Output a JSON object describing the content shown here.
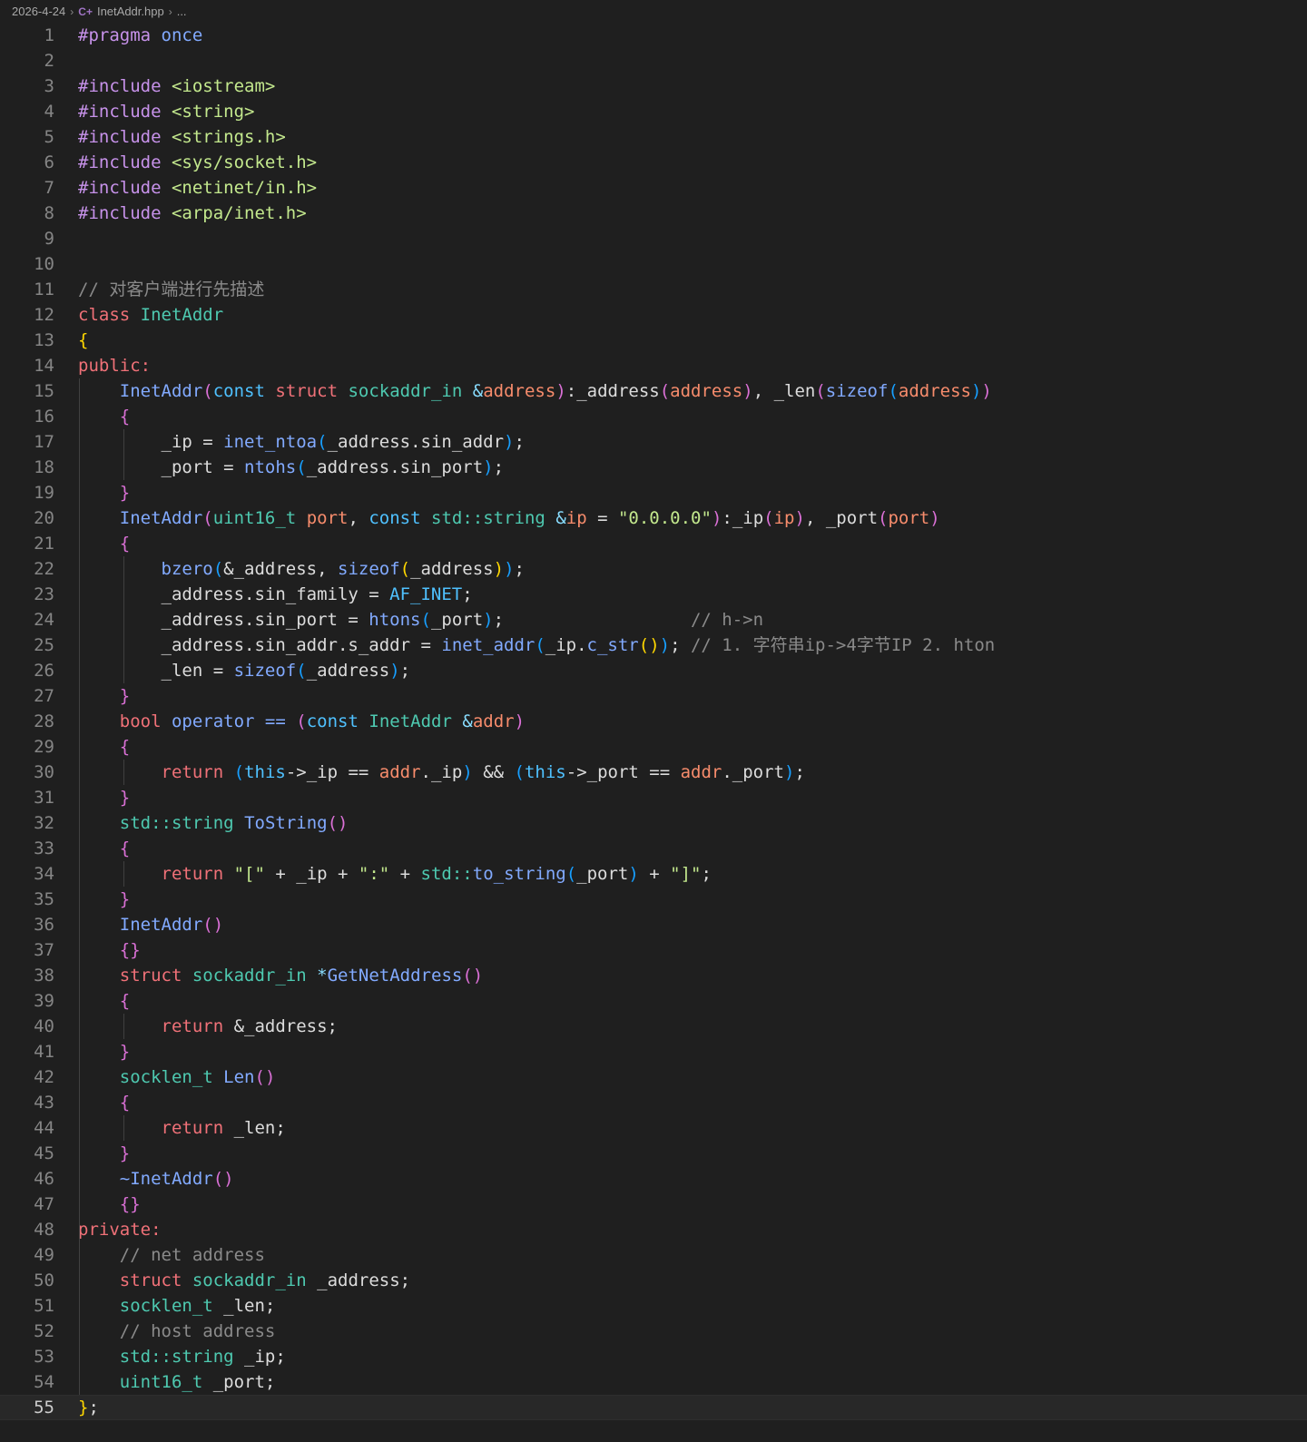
{
  "breadcrumb": {
    "folder": "2026-4-24",
    "file": "InetAddr.hpp",
    "more": "..."
  },
  "editor": {
    "current_line": 55,
    "lines": [
      [
        [
          "t-pp",
          "#pragma"
        ],
        [
          "t-ident",
          " "
        ],
        [
          "t-fn",
          "once"
        ]
      ],
      [],
      [
        [
          "t-pp",
          "#include"
        ],
        [
          "t-ident",
          " "
        ],
        [
          "t-str",
          "<iostream>"
        ]
      ],
      [
        [
          "t-pp",
          "#include"
        ],
        [
          "t-ident",
          " "
        ],
        [
          "t-str",
          "<string>"
        ]
      ],
      [
        [
          "t-pp",
          "#include"
        ],
        [
          "t-ident",
          " "
        ],
        [
          "t-str",
          "<strings.h>"
        ]
      ],
      [
        [
          "t-pp",
          "#include"
        ],
        [
          "t-ident",
          " "
        ],
        [
          "t-str",
          "<sys/socket.h>"
        ]
      ],
      [
        [
          "t-pp",
          "#include"
        ],
        [
          "t-ident",
          " "
        ],
        [
          "t-str",
          "<netinet/in.h>"
        ]
      ],
      [
        [
          "t-pp",
          "#include"
        ],
        [
          "t-ident",
          " "
        ],
        [
          "t-str",
          "<arpa/inet.h>"
        ]
      ],
      [],
      [],
      [
        [
          "t-cm",
          "// 对客户端进行先描述"
        ]
      ],
      [
        [
          "t-kw",
          "class"
        ],
        [
          "t-ident",
          " "
        ],
        [
          "t-type",
          "InetAddr"
        ]
      ],
      [
        [
          "t-b1",
          "{"
        ]
      ],
      [
        [
          "t-kw",
          "public:"
        ]
      ],
      [
        [
          "t-ident",
          "    "
        ],
        [
          "t-fn",
          "InetAddr"
        ],
        [
          "t-b2",
          "("
        ],
        [
          "t-const",
          "const"
        ],
        [
          "t-ident",
          " "
        ],
        [
          "t-kw",
          "struct"
        ],
        [
          "t-ident",
          " "
        ],
        [
          "t-type",
          "sockaddr_in"
        ],
        [
          "t-ident",
          " "
        ],
        [
          "t-op",
          "&"
        ],
        [
          "t-param",
          "address"
        ],
        [
          "t-b2",
          ")"
        ],
        [
          "t-ident",
          ":_address"
        ],
        [
          "t-b2",
          "("
        ],
        [
          "t-param",
          "address"
        ],
        [
          "t-b2",
          ")"
        ],
        [
          "t-ident",
          ", _len"
        ],
        [
          "t-b2",
          "("
        ],
        [
          "t-fn",
          "sizeof"
        ],
        [
          "t-b3",
          "("
        ],
        [
          "t-param",
          "address"
        ],
        [
          "t-b3",
          ")"
        ],
        [
          "t-b2",
          ")"
        ]
      ],
      [
        [
          "t-ident",
          "    "
        ],
        [
          "t-b2",
          "{"
        ]
      ],
      [
        [
          "t-ident",
          "        _ip = "
        ],
        [
          "t-fn",
          "inet_ntoa"
        ],
        [
          "t-b3",
          "("
        ],
        [
          "t-ident",
          "_address.sin_addr"
        ],
        [
          "t-b3",
          ")"
        ],
        [
          "t-ident",
          ";"
        ]
      ],
      [
        [
          "t-ident",
          "        _port = "
        ],
        [
          "t-fn",
          "ntohs"
        ],
        [
          "t-b3",
          "("
        ],
        [
          "t-ident",
          "_address.sin_port"
        ],
        [
          "t-b3",
          ")"
        ],
        [
          "t-ident",
          ";"
        ]
      ],
      [
        [
          "t-ident",
          "    "
        ],
        [
          "t-b2",
          "}"
        ]
      ],
      [
        [
          "t-ident",
          "    "
        ],
        [
          "t-fn",
          "InetAddr"
        ],
        [
          "t-b2",
          "("
        ],
        [
          "t-type",
          "uint16_t"
        ],
        [
          "t-ident",
          " "
        ],
        [
          "t-param",
          "port"
        ],
        [
          "t-ident",
          ", "
        ],
        [
          "t-const",
          "const"
        ],
        [
          "t-ident",
          " "
        ],
        [
          "t-type",
          "std::string"
        ],
        [
          "t-ident",
          " "
        ],
        [
          "t-op",
          "&"
        ],
        [
          "t-param",
          "ip"
        ],
        [
          "t-ident",
          " = "
        ],
        [
          "t-str",
          "\"0.0.0.0\""
        ],
        [
          "t-b2",
          ")"
        ],
        [
          "t-ident",
          ":_ip"
        ],
        [
          "t-b2",
          "("
        ],
        [
          "t-param",
          "ip"
        ],
        [
          "t-b2",
          ")"
        ],
        [
          "t-ident",
          ", _port"
        ],
        [
          "t-b2",
          "("
        ],
        [
          "t-param",
          "port"
        ],
        [
          "t-b2",
          ")"
        ]
      ],
      [
        [
          "t-ident",
          "    "
        ],
        [
          "t-b2",
          "{"
        ]
      ],
      [
        [
          "t-ident",
          "        "
        ],
        [
          "t-fn",
          "bzero"
        ],
        [
          "t-b3",
          "("
        ],
        [
          "t-ident",
          "&_address, "
        ],
        [
          "t-fn",
          "sizeof"
        ],
        [
          "t-b1",
          "("
        ],
        [
          "t-ident",
          "_address"
        ],
        [
          "t-b1",
          ")"
        ],
        [
          "t-b3",
          ")"
        ],
        [
          "t-ident",
          ";"
        ]
      ],
      [
        [
          "t-ident",
          "        _address.sin_family = "
        ],
        [
          "t-const",
          "AF_INET"
        ],
        [
          "t-ident",
          ";"
        ]
      ],
      [
        [
          "t-ident",
          "        _address.sin_port = "
        ],
        [
          "t-fn",
          "htons"
        ],
        [
          "t-b3",
          "("
        ],
        [
          "t-ident",
          "_port"
        ],
        [
          "t-b3",
          ")"
        ],
        [
          "t-ident",
          ";                  "
        ],
        [
          "t-cm",
          "// h->n"
        ]
      ],
      [
        [
          "t-ident",
          "        _address.sin_addr.s_addr = "
        ],
        [
          "t-fn",
          "inet_addr"
        ],
        [
          "t-b3",
          "("
        ],
        [
          "t-ident",
          "_ip."
        ],
        [
          "t-fn",
          "c_str"
        ],
        [
          "t-b1",
          "()"
        ],
        [
          "t-b3",
          ")"
        ],
        [
          "t-ident",
          "; "
        ],
        [
          "t-cm",
          "// 1. 字符串ip->4字节IP 2. hton"
        ]
      ],
      [
        [
          "t-ident",
          "        _len = "
        ],
        [
          "t-fn",
          "sizeof"
        ],
        [
          "t-b3",
          "("
        ],
        [
          "t-ident",
          "_address"
        ],
        [
          "t-b3",
          ")"
        ],
        [
          "t-ident",
          ";"
        ]
      ],
      [
        [
          "t-ident",
          "    "
        ],
        [
          "t-b2",
          "}"
        ]
      ],
      [
        [
          "t-ident",
          "    "
        ],
        [
          "t-kw",
          "bool"
        ],
        [
          "t-ident",
          " "
        ],
        [
          "t-fn",
          "operator =="
        ],
        [
          "t-ident",
          " "
        ],
        [
          "t-b2",
          "("
        ],
        [
          "t-const",
          "const"
        ],
        [
          "t-ident",
          " "
        ],
        [
          "t-type",
          "InetAddr"
        ],
        [
          "t-ident",
          " "
        ],
        [
          "t-op",
          "&"
        ],
        [
          "t-param",
          "addr"
        ],
        [
          "t-b2",
          ")"
        ]
      ],
      [
        [
          "t-ident",
          "    "
        ],
        [
          "t-b2",
          "{"
        ]
      ],
      [
        [
          "t-ident",
          "        "
        ],
        [
          "t-kw",
          "return"
        ],
        [
          "t-ident",
          " "
        ],
        [
          "t-b3",
          "("
        ],
        [
          "t-const",
          "this"
        ],
        [
          "t-ident",
          "->_ip == "
        ],
        [
          "t-param",
          "addr"
        ],
        [
          "t-ident",
          "._ip"
        ],
        [
          "t-b3",
          ")"
        ],
        [
          "t-ident",
          " && "
        ],
        [
          "t-b3",
          "("
        ],
        [
          "t-const",
          "this"
        ],
        [
          "t-ident",
          "->_port == "
        ],
        [
          "t-param",
          "addr"
        ],
        [
          "t-ident",
          "._port"
        ],
        [
          "t-b3",
          ")"
        ],
        [
          "t-ident",
          ";"
        ]
      ],
      [
        [
          "t-ident",
          "    "
        ],
        [
          "t-b2",
          "}"
        ]
      ],
      [
        [
          "t-ident",
          "    "
        ],
        [
          "t-type",
          "std::string"
        ],
        [
          "t-ident",
          " "
        ],
        [
          "t-fn",
          "ToString"
        ],
        [
          "t-b2",
          "()"
        ]
      ],
      [
        [
          "t-ident",
          "    "
        ],
        [
          "t-b2",
          "{"
        ]
      ],
      [
        [
          "t-ident",
          "        "
        ],
        [
          "t-kw",
          "return"
        ],
        [
          "t-ident",
          " "
        ],
        [
          "t-str",
          "\"[\""
        ],
        [
          "t-ident",
          " + _ip + "
        ],
        [
          "t-str",
          "\":\""
        ],
        [
          "t-ident",
          " + "
        ],
        [
          "t-type",
          "std::"
        ],
        [
          "t-fn",
          "to_string"
        ],
        [
          "t-b3",
          "("
        ],
        [
          "t-ident",
          "_port"
        ],
        [
          "t-b3",
          ")"
        ],
        [
          "t-ident",
          " + "
        ],
        [
          "t-str",
          "\"]\""
        ],
        [
          "t-ident",
          ";"
        ]
      ],
      [
        [
          "t-ident",
          "    "
        ],
        [
          "t-b2",
          "}"
        ]
      ],
      [
        [
          "t-ident",
          "    "
        ],
        [
          "t-fn",
          "InetAddr"
        ],
        [
          "t-b2",
          "()"
        ]
      ],
      [
        [
          "t-ident",
          "    "
        ],
        [
          "t-b2",
          "{}"
        ]
      ],
      [
        [
          "t-ident",
          "    "
        ],
        [
          "t-kw",
          "struct"
        ],
        [
          "t-ident",
          " "
        ],
        [
          "t-type",
          "sockaddr_in"
        ],
        [
          "t-ident",
          " "
        ],
        [
          "t-op",
          "*"
        ],
        [
          "t-fn",
          "GetNetAddress"
        ],
        [
          "t-b2",
          "()"
        ]
      ],
      [
        [
          "t-ident",
          "    "
        ],
        [
          "t-b2",
          "{"
        ]
      ],
      [
        [
          "t-ident",
          "        "
        ],
        [
          "t-kw",
          "return"
        ],
        [
          "t-ident",
          " &_address;"
        ]
      ],
      [
        [
          "t-ident",
          "    "
        ],
        [
          "t-b2",
          "}"
        ]
      ],
      [
        [
          "t-ident",
          "    "
        ],
        [
          "t-type",
          "socklen_t"
        ],
        [
          "t-ident",
          " "
        ],
        [
          "t-fn",
          "Len"
        ],
        [
          "t-b2",
          "()"
        ]
      ],
      [
        [
          "t-ident",
          "    "
        ],
        [
          "t-b2",
          "{"
        ]
      ],
      [
        [
          "t-ident",
          "        "
        ],
        [
          "t-kw",
          "return"
        ],
        [
          "t-ident",
          " _len;"
        ]
      ],
      [
        [
          "t-ident",
          "    "
        ],
        [
          "t-b2",
          "}"
        ]
      ],
      [
        [
          "t-ident",
          "    "
        ],
        [
          "t-fn",
          "~InetAddr"
        ],
        [
          "t-b2",
          "()"
        ]
      ],
      [
        [
          "t-ident",
          "    "
        ],
        [
          "t-b2",
          "{}"
        ]
      ],
      [
        [
          "t-kw",
          "private:"
        ]
      ],
      [
        [
          "t-ident",
          "    "
        ],
        [
          "t-cm",
          "// net address"
        ]
      ],
      [
        [
          "t-ident",
          "    "
        ],
        [
          "t-kw",
          "struct"
        ],
        [
          "t-ident",
          " "
        ],
        [
          "t-type",
          "sockaddr_in"
        ],
        [
          "t-ident",
          " _address;"
        ]
      ],
      [
        [
          "t-ident",
          "    "
        ],
        [
          "t-type",
          "socklen_t"
        ],
        [
          "t-ident",
          " _len;"
        ]
      ],
      [
        [
          "t-ident",
          "    "
        ],
        [
          "t-cm",
          "// host address"
        ]
      ],
      [
        [
          "t-ident",
          "    "
        ],
        [
          "t-type",
          "std::string"
        ],
        [
          "t-ident",
          " _ip;"
        ]
      ],
      [
        [
          "t-ident",
          "    "
        ],
        [
          "t-type",
          "uint16_t"
        ],
        [
          "t-ident",
          " _port;"
        ]
      ],
      [
        [
          "t-b1",
          "}"
        ],
        [
          "t-ident",
          ";"
        ]
      ]
    ]
  }
}
